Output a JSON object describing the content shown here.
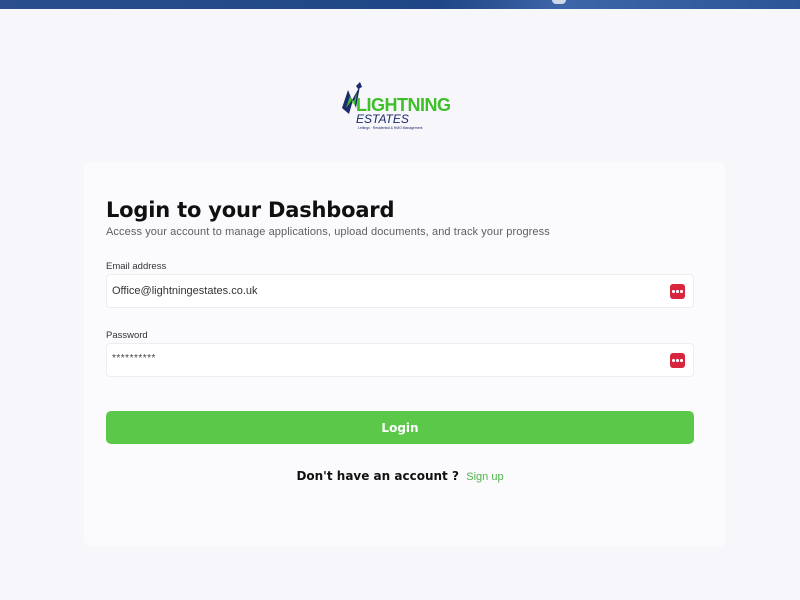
{
  "brand": {
    "name": "LIGHTNING",
    "sub": "ESTATES",
    "tagline": "Lettings · Residential & HMO Management",
    "colors": {
      "green": "#3fbf2a",
      "navy": "#1b2a6b"
    }
  },
  "login": {
    "title": "Login to your Dashboard",
    "subtitle": "Access your account to manage applications, upload documents, and track your progress",
    "email_label": "Email address",
    "email_value": "Office@lightningestates.co.uk",
    "password_label": "Password",
    "password_value": "**********",
    "button_label": "Login",
    "signup_prompt": "Don't have an account ?",
    "signup_link": "Sign up",
    "accent_color": "#5bc84a",
    "password_manager_icon": "password-manager-icon"
  }
}
